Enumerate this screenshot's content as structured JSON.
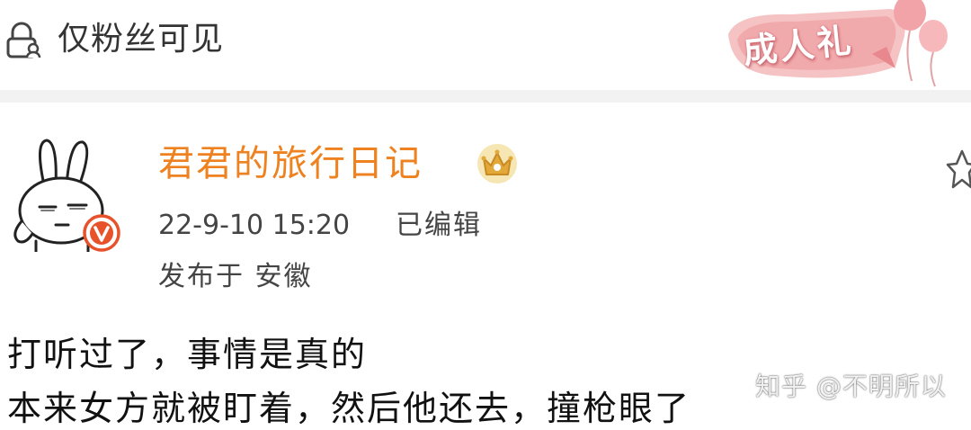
{
  "visibility": {
    "label": "仅粉丝可见",
    "icon": "lock-person-icon"
  },
  "badge": {
    "label": "成人礼",
    "icon": "balloon-icon"
  },
  "post": {
    "author": {
      "name": "君君的旅行日记",
      "avatar_icon": "bunny-avatar-icon",
      "verified_icon": "verified-v-icon",
      "member_icon": "crown-icon"
    },
    "time": "22-9-10 15:20",
    "edited": "已编辑",
    "location": "发布于 安徽",
    "favorite_icon": "star-icon",
    "body": [
      "打听过了，事情是真的",
      "本来女方就被盯着，然后他还去，撞枪眼了"
    ]
  },
  "watermark": {
    "text": "知乎 @不明所以"
  },
  "colors": {
    "username": "#ee8220",
    "verified": "#e8522a",
    "badge": "#f3b7b9"
  }
}
